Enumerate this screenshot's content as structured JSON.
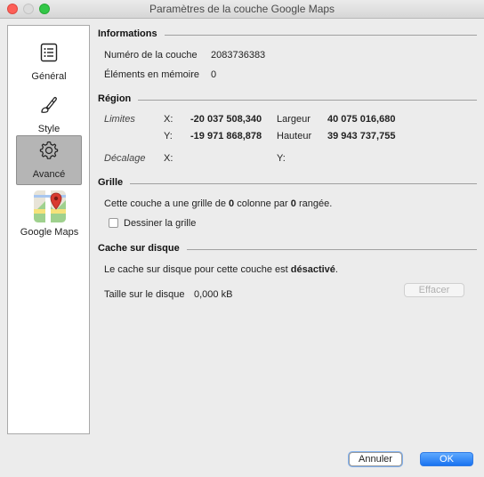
{
  "window": {
    "title": "Paramètres de la couche Google Maps"
  },
  "sidebar": {
    "items": [
      {
        "label": "Général",
        "icon": "list-icon",
        "selected": false
      },
      {
        "label": "Style",
        "icon": "brush-icon",
        "selected": false
      },
      {
        "label": "Avancé",
        "icon": "gear-icon",
        "selected": true
      },
      {
        "label": "Google Maps",
        "icon": "google-maps-icon",
        "selected": false
      }
    ]
  },
  "informations": {
    "title": "Informations",
    "layer_number_label": "Numéro de la couche",
    "layer_number_value": "2083736383",
    "memory_label": "Éléments en mémoire",
    "memory_value": "0"
  },
  "region": {
    "title": "Région",
    "limits_label": "Limites",
    "x_label": "X:",
    "y_label": "Y:",
    "x_value": "-20 037 508,340",
    "y_value": "-19 971 868,878",
    "width_label": "Largeur",
    "width_value": "40 075 016,680",
    "height_label": "Hauteur",
    "height_value": "39 943 737,755",
    "offset_label": "Décalage",
    "offset_x_label": "X:",
    "offset_y_label": "Y:"
  },
  "grid": {
    "title": "Grille",
    "text_before": "Cette couche a une grille de ",
    "columns": "0",
    "text_middle": " colonne par ",
    "rows": "0",
    "text_after": " rangée.",
    "draw_grid_label": "Dessiner la grille",
    "draw_grid_checked": false
  },
  "cache": {
    "title": "Cache sur disque",
    "status_text": "Le cache sur disque pour cette couche est ",
    "status_value": "désactivé",
    "status_end": ".",
    "size_label": "Taille sur le disque",
    "size_value": "0,000 kB",
    "clear_label": "Effacer"
  },
  "footer": {
    "cancel_label": "Annuler",
    "ok_label": "OK"
  },
  "colors": {
    "accent": "#1a73f0",
    "selected_bg": "#b5b5b5"
  }
}
